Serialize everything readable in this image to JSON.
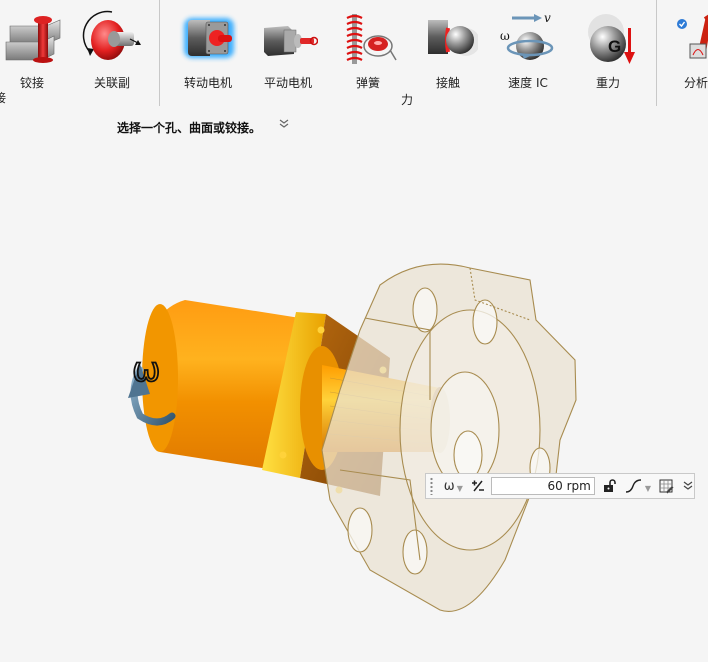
{
  "ribbon": {
    "tools": [
      {
        "id": "pin-joint",
        "label": "铰接",
        "icon": "pin-joint-icon"
      },
      {
        "id": "coupler",
        "label": "关联副",
        "icon": "coupler-icon"
      },
      {
        "id": "rotary-motor",
        "label": "转动电机",
        "icon": "rotary-motor-icon",
        "active": true
      },
      {
        "id": "linear-motor",
        "label": "平动电机",
        "icon": "linear-motor-icon"
      },
      {
        "id": "spring",
        "label": "弹簧",
        "icon": "spring-icon"
      },
      {
        "id": "contact",
        "label": "接触",
        "icon": "contact-icon"
      },
      {
        "id": "initial-velocity",
        "label": "速度 IC",
        "icon": "initial-velocity-icon"
      },
      {
        "id": "gravity",
        "label": "重力",
        "icon": "gravity-icon"
      },
      {
        "id": "analysis",
        "label": "分析",
        "icon": "analysis-icon"
      }
    ],
    "group_labels": {
      "left_partial": "接",
      "force": "力"
    }
  },
  "prompt": {
    "text": "选择一个孔、曲面或铰接。",
    "expand_icon": "double-chevron-down-icon"
  },
  "viewport": {
    "motor_color": "#f59a0a",
    "flange_color": "#e9e2d2",
    "flange_edge_color": "#a88c50",
    "omega_glyph": "ω"
  },
  "motor_toolbar": {
    "type_symbol": "ω",
    "plus_minus": "+⁄−",
    "speed_value": "60 rpm",
    "lock_icon": "unlock-icon",
    "profile_icon": "curve-icon",
    "table_icon": "table-edit-icon",
    "more_icon": "double-chevron-down-icon"
  }
}
